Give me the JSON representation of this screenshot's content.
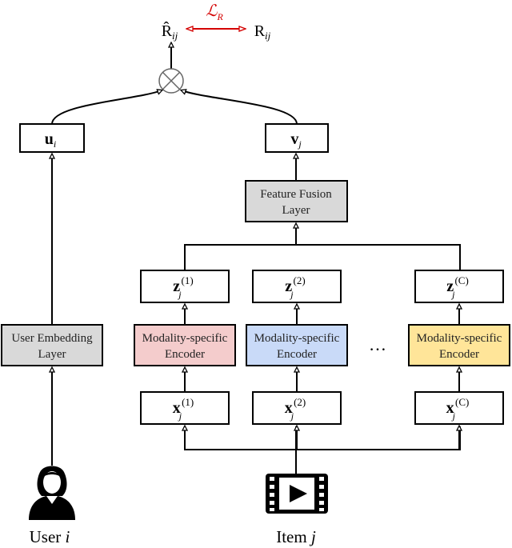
{
  "colors": {
    "loss": "#d40000",
    "encoder_1": "#f4cccc",
    "encoder_2": "#c9daf8",
    "encoder_c": "#ffe599",
    "layer_gray": "#d9d9d9"
  },
  "top": {
    "pred": "R̂",
    "pred_sub": "ij",
    "target": "R",
    "target_sub": "ij",
    "loss": "ℒ",
    "loss_sub": "R",
    "op": "⊗"
  },
  "user": {
    "vec": "u",
    "vec_sub": "i",
    "layer": [
      "User Embedding",
      "Layer"
    ],
    "label": "User ",
    "label_var": "i",
    "icon": "user-icon"
  },
  "item": {
    "vec": "v",
    "vec_sub": "j",
    "fusion": [
      "Feature Fusion",
      "Layer"
    ],
    "label": "Item ",
    "label_var": "j",
    "icon": "video-icon"
  },
  "modalities": [
    {
      "z": "z",
      "x": "x",
      "sub": "j",
      "sup": "(1)",
      "encoder": [
        "Modality-specific",
        "Encoder"
      ]
    },
    {
      "z": "z",
      "x": "x",
      "sub": "j",
      "sup": "(2)",
      "encoder": [
        "Modality-specific",
        "Encoder"
      ]
    },
    {
      "z": "z",
      "x": "x",
      "sub": "j",
      "sup": "(C)",
      "encoder": [
        "Modality-specific",
        "Encoder"
      ]
    }
  ],
  "ellipsis": "…"
}
